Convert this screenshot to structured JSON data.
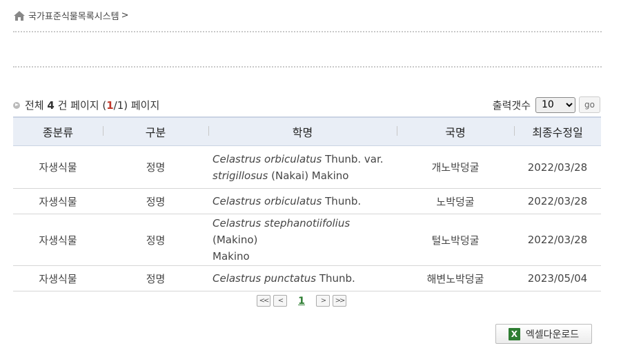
{
  "breadcrumb": {
    "root": "국가표준식물목록시스템",
    "separator": ">"
  },
  "summary": {
    "prefix": "전체",
    "total": "4",
    "unit": "건 페이지 (",
    "current": "1",
    "pages": "/1) 페이지"
  },
  "output_count": {
    "label": "출력갯수",
    "selected": "10",
    "go": "go"
  },
  "table": {
    "headers": [
      "종분류",
      "구분",
      "학명",
      "국명",
      "최종수정일"
    ],
    "rows": [
      {
        "category": "자생식물",
        "type": "정명",
        "sci_genus_species": "Celastrus orbiculatus",
        "sci_author": " Thunb. var.",
        "sci_infra": "strigillosus",
        "sci_infra_author": " (Nakai) Makino",
        "korean": "개노박덩굴",
        "date": "2022/03/28"
      },
      {
        "category": "자생식물",
        "type": "정명",
        "sci_genus_species": "Celastrus orbiculatus",
        "sci_author": " Thunb.",
        "korean": "노박덩굴",
        "date": "2022/03/28"
      },
      {
        "category": "자생식물",
        "type": "정명",
        "sci_genus_species": "Celastrus stephanotiifolius",
        "sci_author": " (Makino)",
        "sci_author2": "Makino",
        "korean": "털노박덩굴",
        "date": "2022/03/28"
      },
      {
        "category": "자생식물",
        "type": "정명",
        "sci_genus_species": "Celastrus punctatus",
        "sci_author": " Thunb.",
        "korean": "해변노박덩굴",
        "date": "2023/05/04"
      }
    ]
  },
  "pagination": {
    "first": "<<",
    "prev": "<",
    "current": "1",
    "next": ">",
    "last": ">>"
  },
  "excel_button": {
    "icon_letter": "X",
    "label": "엑셀다운로드"
  }
}
